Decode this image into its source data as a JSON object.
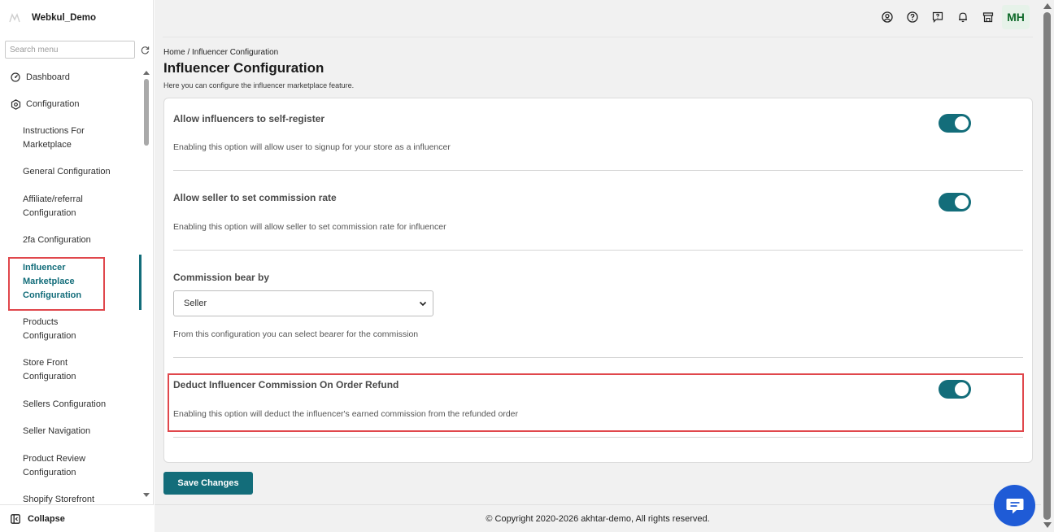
{
  "app": {
    "store_name": "Webkul_Demo"
  },
  "sidebar": {
    "search_placeholder": "Search menu",
    "dashboard": "Dashboard",
    "configuration": "Configuration",
    "items": [
      {
        "label": "Instructions For Marketplace"
      },
      {
        "label": "General Configuration"
      },
      {
        "label": "Affiliate/referral Configuration"
      },
      {
        "label": "2fa Configuration"
      },
      {
        "label": "Influencer Marketplace Configuration"
      },
      {
        "label": "Products Configuration"
      },
      {
        "label": "Store Front Configuration"
      },
      {
        "label": "Sellers Configuration"
      },
      {
        "label": "Seller Navigation"
      },
      {
        "label": "Product Review Configuration"
      },
      {
        "label": "Shopify Storefront"
      }
    ],
    "active_index": 4,
    "collapse_label": "Collapse"
  },
  "header": {
    "avatar_initials": "MH"
  },
  "page": {
    "breadcrumb": "Home / Influencer Configuration",
    "title": "Influencer Configuration",
    "subtitle": "Here you can configure the influencer marketplace feature."
  },
  "settings": {
    "self_register": {
      "title": "Allow influencers to self-register",
      "description": "Enabling this option will allow user to signup for your store as a influencer",
      "enabled": true
    },
    "seller_commission": {
      "title": "Allow seller to set commission rate",
      "description": "Enabling this option will allow seller to set commission rate for influencer",
      "enabled": true
    },
    "commission_bearer": {
      "title": "Commission bear by",
      "selected": "Seller",
      "description": "From this configuration you can select bearer for the commission"
    },
    "refund_deduct": {
      "title": "Deduct Influencer Commission On Order Refund",
      "description": "Enabling this option will deduct the influencer's earned commission from the refunded order",
      "enabled": true
    }
  },
  "actions": {
    "save_label": "Save Changes"
  },
  "footer": {
    "copyright": "© Copyright 2020-2026 akhtar-demo, All rights reserved."
  },
  "colors": {
    "accent": "#136d7a",
    "highlight": "#e0474c",
    "chat": "#1f5bd6"
  },
  "icons": [
    "store-logo-icon",
    "refresh-icon",
    "dashboard-icon",
    "configuration-icon",
    "collapse-icon",
    "account-icon",
    "help-icon",
    "feedback-icon",
    "bell-icon",
    "store-icon",
    "chevron-down-icon",
    "chat-icon"
  ]
}
